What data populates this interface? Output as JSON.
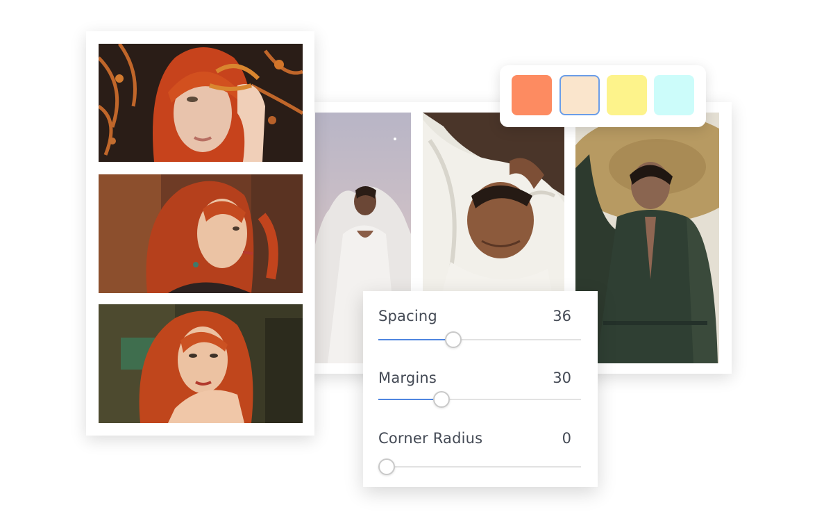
{
  "color_picker": {
    "swatches": [
      {
        "name": "coral",
        "color": "#fd8b61",
        "selected": false
      },
      {
        "name": "cream",
        "color": "#fae5cc",
        "selected": true
      },
      {
        "name": "yellow",
        "color": "#fdf38b",
        "selected": false
      },
      {
        "name": "aqua",
        "color": "#ccfcfa",
        "selected": false
      }
    ],
    "selection_color": "#6a9de8"
  },
  "sliders": [
    {
      "label": "Spacing",
      "value": "36",
      "fraction": 0.37
    },
    {
      "label": "Margins",
      "value": "30",
      "fraction": 0.31
    },
    {
      "label": "Corner Radius",
      "value": "0",
      "fraction": 0.0
    }
  ],
  "slider_accent": "#4f86e0",
  "photos": [
    "red-hair-woman-autumn-leaves",
    "red-hair-woman-profile",
    "red-hair-woman-hand-chin",
    "woman-white-dress-sky",
    "man-white-fabric-lying",
    "woman-straw-hat-green-dress"
  ]
}
